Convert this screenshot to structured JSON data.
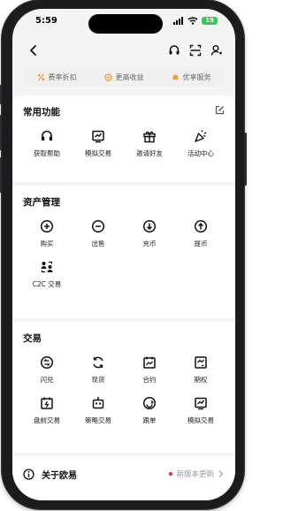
{
  "status_bar": {
    "time": "5:59",
    "battery": "19"
  },
  "promo": [
    {
      "label": "费率折扣",
      "icon": "percent-icon",
      "color": "#f29d38"
    },
    {
      "label": "更高收益",
      "icon": "coin-icon",
      "color": "#f29d38"
    },
    {
      "label": "优享服务",
      "icon": "vip-icon",
      "color": "#f29d38"
    }
  ],
  "sections": {
    "common": {
      "title": "常用功能",
      "items": [
        {
          "label": "获取帮助",
          "icon": "headset-icon"
        },
        {
          "label": "模拟交易",
          "icon": "demo-trade-icon"
        },
        {
          "label": "邀请好友",
          "icon": "gift-icon"
        },
        {
          "label": "活动中心",
          "icon": "party-icon"
        }
      ]
    },
    "assets": {
      "title": "资产管理",
      "items": [
        {
          "label": "购买",
          "icon": "plus-circle-icon"
        },
        {
          "label": "出售",
          "icon": "minus-circle-icon"
        },
        {
          "label": "充币",
          "icon": "deposit-icon"
        },
        {
          "label": "提币",
          "icon": "withdraw-icon"
        },
        {
          "label": "C2C 交易",
          "icon": "c2c-icon"
        }
      ]
    },
    "trade": {
      "title": "交易",
      "items": [
        {
          "label": "闪兑",
          "icon": "flash-convert-icon"
        },
        {
          "label": "现货",
          "icon": "spot-icon"
        },
        {
          "label": "合约",
          "icon": "contract-icon"
        },
        {
          "label": "期权",
          "icon": "options-icon"
        },
        {
          "label": "盘前交易",
          "icon": "premarket-icon"
        },
        {
          "label": "策略交易",
          "icon": "bot-icon"
        },
        {
          "label": "跟单",
          "icon": "copy-trade-icon"
        },
        {
          "label": "模拟交易",
          "icon": "demo-trade-icon"
        }
      ]
    }
  },
  "about": {
    "title": "关于欧易",
    "update_text": "新版本更新"
  },
  "colors": {
    "accent_orange": "#f29d38",
    "update_dot": "#e0245e",
    "battery_green": "#34c759"
  }
}
